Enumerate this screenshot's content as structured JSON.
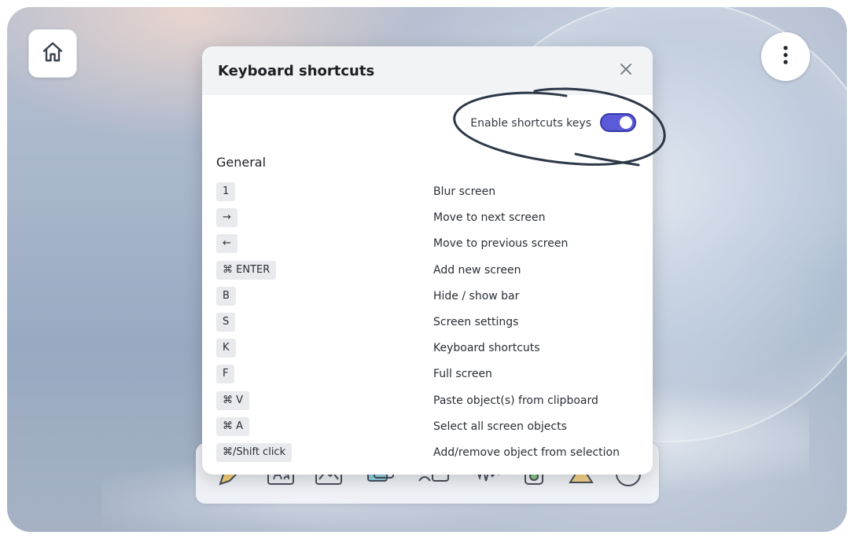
{
  "modal": {
    "title": "Keyboard shortcuts",
    "toggle_label": "Enable shortcuts keys",
    "toggle_on": true,
    "section_title": "General",
    "shortcuts": [
      {
        "key": "1",
        "action": "Blur screen"
      },
      {
        "key": "→",
        "action": "Move to next screen"
      },
      {
        "key": "←",
        "action": "Move to previous screen"
      },
      {
        "key": "⌘ ENTER",
        "action": "Add new screen"
      },
      {
        "key": "B",
        "action": "Hide / show bar"
      },
      {
        "key": "S",
        "action": "Screen settings"
      },
      {
        "key": "K",
        "action": "Keyboard shortcuts"
      },
      {
        "key": "F",
        "action": "Full screen"
      },
      {
        "key": "⌘ V",
        "action": "Paste object(s) from clipboard"
      },
      {
        "key": "⌘ A",
        "action": "Select all screen objects"
      },
      {
        "key": "⌘/Shift click",
        "action": "Add/remove object from selection"
      }
    ]
  },
  "icons": {
    "home": "home-icon",
    "more": "more-vertical-icon",
    "close": "close-icon"
  },
  "colors": {
    "toggle_on": "#5b5ad8",
    "scribble": "#2c3848"
  }
}
